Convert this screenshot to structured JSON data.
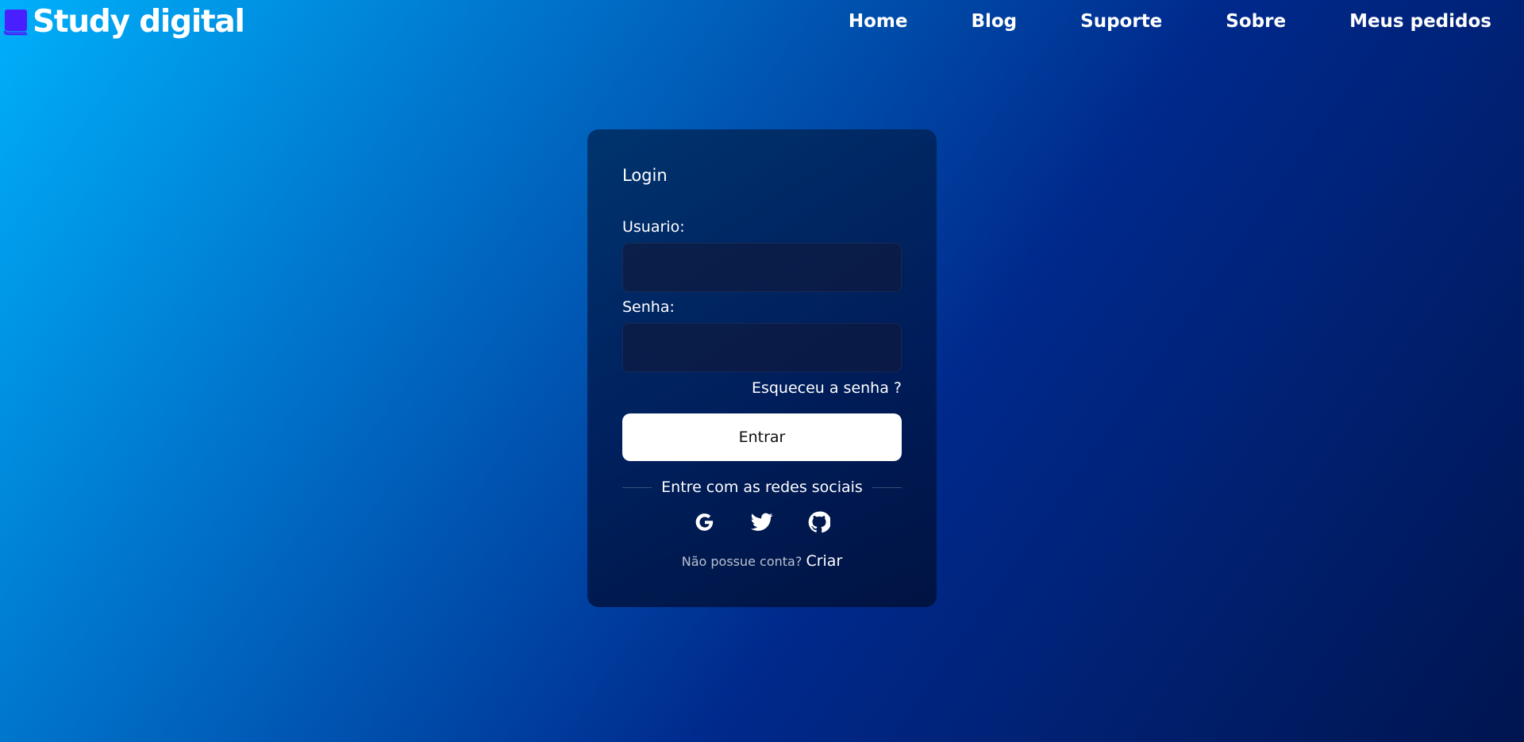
{
  "header": {
    "brand": {
      "icon": "book-icon",
      "icon_color": "#4a1fff",
      "title": "Study digital"
    },
    "nav": [
      {
        "label": "Home"
      },
      {
        "label": "Blog"
      },
      {
        "label": "Suporte"
      },
      {
        "label": "Sobre"
      },
      {
        "label": "Meus pedidos"
      }
    ]
  },
  "login": {
    "title": "Login",
    "username_label": "Usuario:",
    "username_value": "",
    "password_label": "Senha:",
    "password_value": "",
    "forgot_label": "Esqueceu a senha ?",
    "submit_label": "Entrar",
    "social_label": "Entre com as redes sociais",
    "social_icons": [
      "google-icon",
      "twitter-icon",
      "github-icon"
    ],
    "no_account_text": "Não possue conta?",
    "create_label": "Criar"
  },
  "colors": {
    "background_gradient": [
      "#00b0fb",
      "#0070c8",
      "#00298c",
      "#001550"
    ],
    "card": "#00205a",
    "button": "#ffffff",
    "button_text": "#0d0d0d"
  }
}
